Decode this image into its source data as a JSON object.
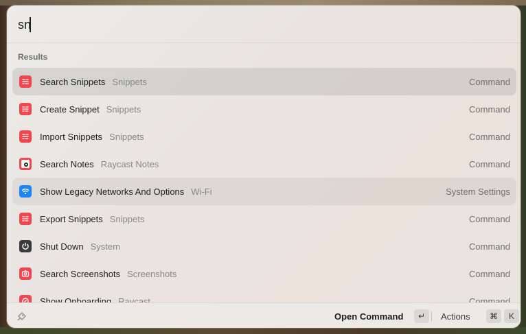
{
  "search": {
    "value": "sn",
    "placeholder": ""
  },
  "section": {
    "label": "Results"
  },
  "results": [
    {
      "title": "Search Snippets",
      "subtitle": "Snippets",
      "type": "Command",
      "icon": "snippets-icon",
      "icon_color": "#f0464e",
      "state": "selected"
    },
    {
      "title": "Create Snippet",
      "subtitle": "Snippets",
      "type": "Command",
      "icon": "snippets-icon",
      "icon_color": "#f0464e",
      "state": ""
    },
    {
      "title": "Import Snippets",
      "subtitle": "Snippets",
      "type": "Command",
      "icon": "snippets-icon",
      "icon_color": "#f0464e",
      "state": ""
    },
    {
      "title": "Search Notes",
      "subtitle": "Raycast Notes",
      "type": "Command",
      "icon": "raycast-notes-icon",
      "icon_color": "#f0464e",
      "state": ""
    },
    {
      "title": "Show Legacy Networks And Options",
      "subtitle": "Wi-Fi",
      "type": "System Settings",
      "icon": "wifi-icon",
      "icon_color": "#1e84f5",
      "state": "hovered"
    },
    {
      "title": "Export Snippets",
      "subtitle": "Snippets",
      "type": "Command",
      "icon": "snippets-icon",
      "icon_color": "#f0464e",
      "state": ""
    },
    {
      "title": "Shut Down",
      "subtitle": "System",
      "type": "Command",
      "icon": "power-icon",
      "icon_color": "#3a3a3c",
      "state": ""
    },
    {
      "title": "Search Screenshots",
      "subtitle": "Screenshots",
      "type": "Command",
      "icon": "screenshot-icon",
      "icon_color": "#f0464e",
      "state": ""
    },
    {
      "title": "Show Onboarding",
      "subtitle": "Raycast",
      "type": "Command",
      "icon": "onboarding-icon",
      "icon_color": "#f0464e",
      "state": ""
    }
  ],
  "footer": {
    "primary_action": "Open Command",
    "primary_key": "↵",
    "actions_label": "Actions",
    "actions_keys": [
      "⌘",
      "K"
    ]
  }
}
